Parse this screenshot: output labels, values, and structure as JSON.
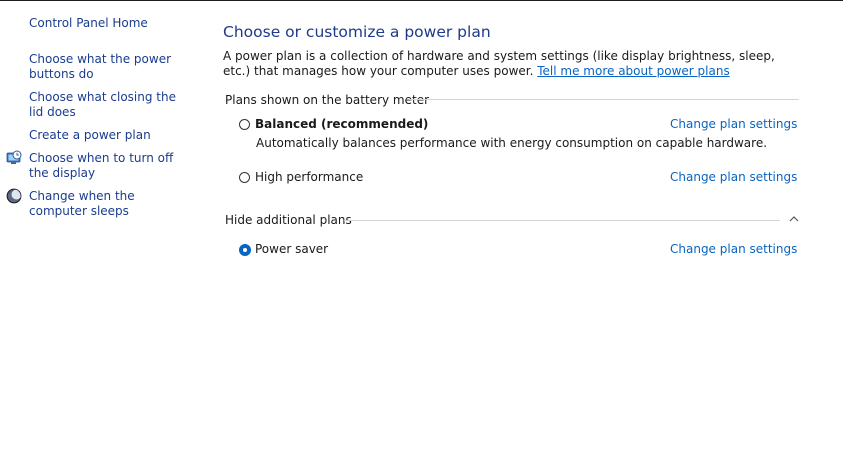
{
  "sidebar": {
    "home": "Control Panel Home",
    "items": [
      {
        "label": "Choose what the power buttons do",
        "icon": "none"
      },
      {
        "label": "Choose what closing the lid does",
        "icon": "none"
      },
      {
        "label": "Create a power plan",
        "icon": "none"
      },
      {
        "label": "Choose when to turn off the display",
        "icon": "display-clock-icon"
      },
      {
        "label": "Change when the computer sleeps",
        "icon": "moon-sleep-icon"
      }
    ]
  },
  "main": {
    "title": "Choose or customize a power plan",
    "description": "A power plan is a collection of hardware and system settings (like display brightness, sleep, etc.) that manages how your computer uses power.",
    "learn_more": "Tell me more about power plans",
    "battery_group": {
      "header": "Plans shown on the battery meter",
      "plans": [
        {
          "name": "Balanced (recommended)",
          "description": "Automatically balances performance with energy consumption on capable hardware.",
          "selected": false,
          "change_label": "Change plan settings"
        },
        {
          "name": "High performance",
          "description": "",
          "selected": false,
          "change_label": "Change plan settings"
        }
      ]
    },
    "additional_group": {
      "header": "Hide additional plans",
      "plans": [
        {
          "name": "Power saver",
          "selected": true,
          "change_label": "Change plan settings"
        }
      ]
    }
  },
  "colors": {
    "link": "#0a64c2",
    "nav_link": "#1a3d8f",
    "title": "#1e3a8a",
    "radio_selected": "#0a64c2"
  }
}
